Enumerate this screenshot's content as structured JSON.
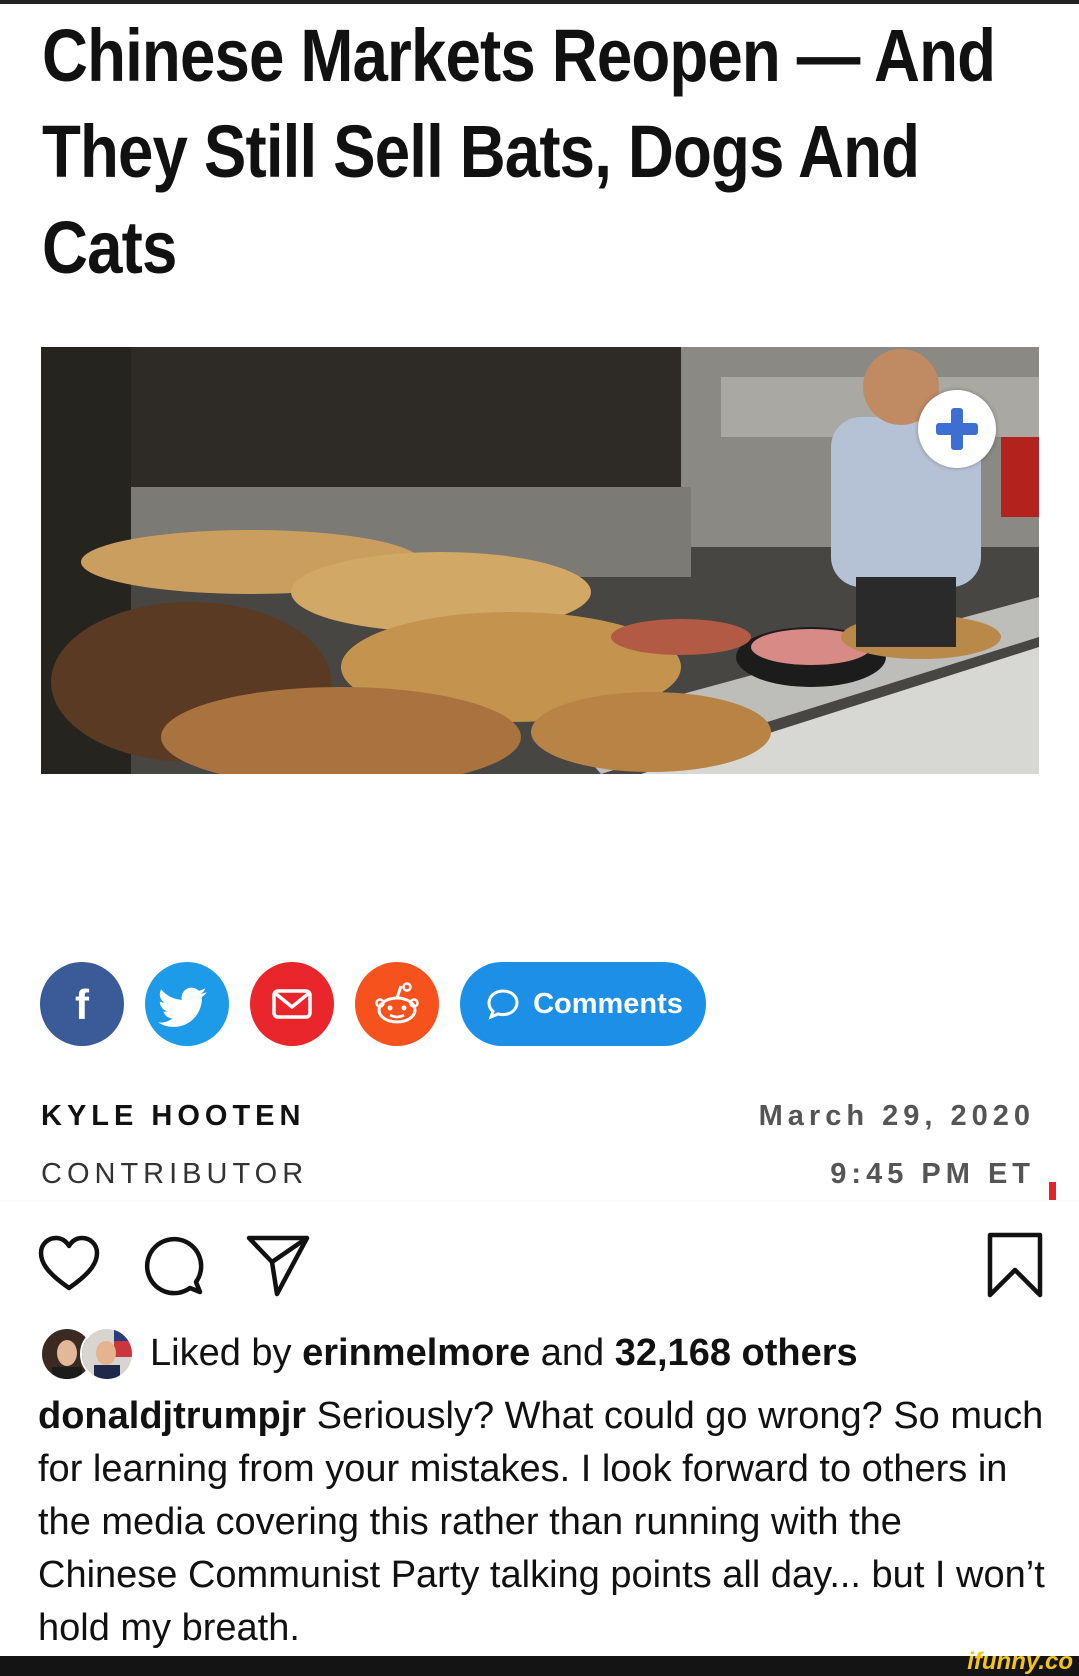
{
  "article": {
    "headline_line1": "Chinese Markets Reopen — And",
    "headline_line2": "They Still Sell Bats, Dogs And",
    "headline_line3": "Cats",
    "comments_label": "Comments",
    "author_name": "KYLE HOOTEN",
    "author_role": "CONTRIBUTOR",
    "date": "March 29, 2020",
    "time": "9:45 PM ET"
  },
  "share_icons": [
    "facebook-icon",
    "twitter-icon",
    "email-icon",
    "reddit-icon",
    "comment-bubble-icon"
  ],
  "instagram": {
    "liked_prefix": "Liked by",
    "liked_user": "erinmelmore",
    "liked_and": "and",
    "liked_count": "32,168 others",
    "caption_user": "donaldjtrumpjr",
    "caption_text": "Seriously? What could go wrong? So much for learning from your mistakes. I look forward to others in the media covering this rather than running with the Chinese Communist Party talking points all day... but I won’t hold my breath.",
    "action_icons": [
      "heart-icon",
      "comment-icon",
      "share-icon",
      "bookmark-icon"
    ]
  },
  "watermark": "ifunny.co",
  "colors": {
    "facebook": "#3b5a98",
    "twitter": "#1d9be9",
    "email": "#e8262b",
    "reddit": "#f5521d",
    "comments": "#1d8fe6"
  }
}
